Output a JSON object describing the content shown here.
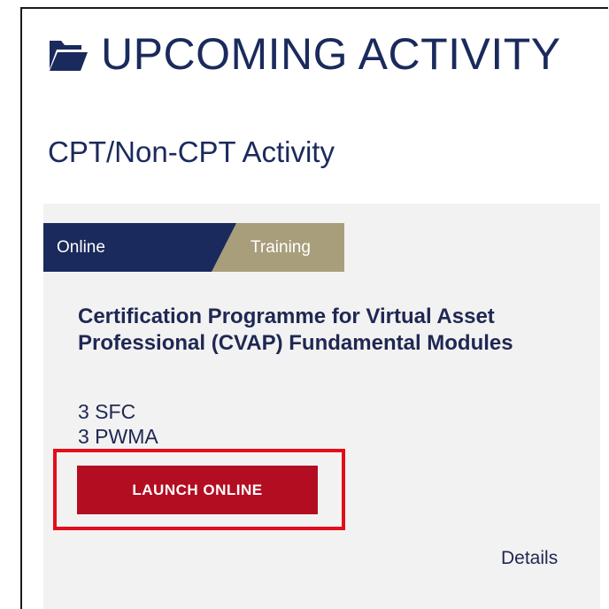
{
  "header": {
    "title": "UPCOMING ACTIVITY",
    "icon": "folder-icon",
    "subtitle": "CPT/Non-CPT Activity"
  },
  "activity": {
    "tags": {
      "primary": "Online",
      "secondary": "Training"
    },
    "title": "Certification Programme for Virtual Asset Professional (CVAP) Fundamental Modules",
    "credits": [
      "3 SFC",
      "3 PWMA"
    ],
    "launch_label": "LAUNCH ONLINE",
    "details_label": "Details"
  },
  "colors": {
    "navy": "#1b2a5c",
    "tan": "#a89e7c",
    "button_red": "#b30d22",
    "highlight_red": "#e10f1a",
    "card_bg": "#f2f2f2"
  }
}
